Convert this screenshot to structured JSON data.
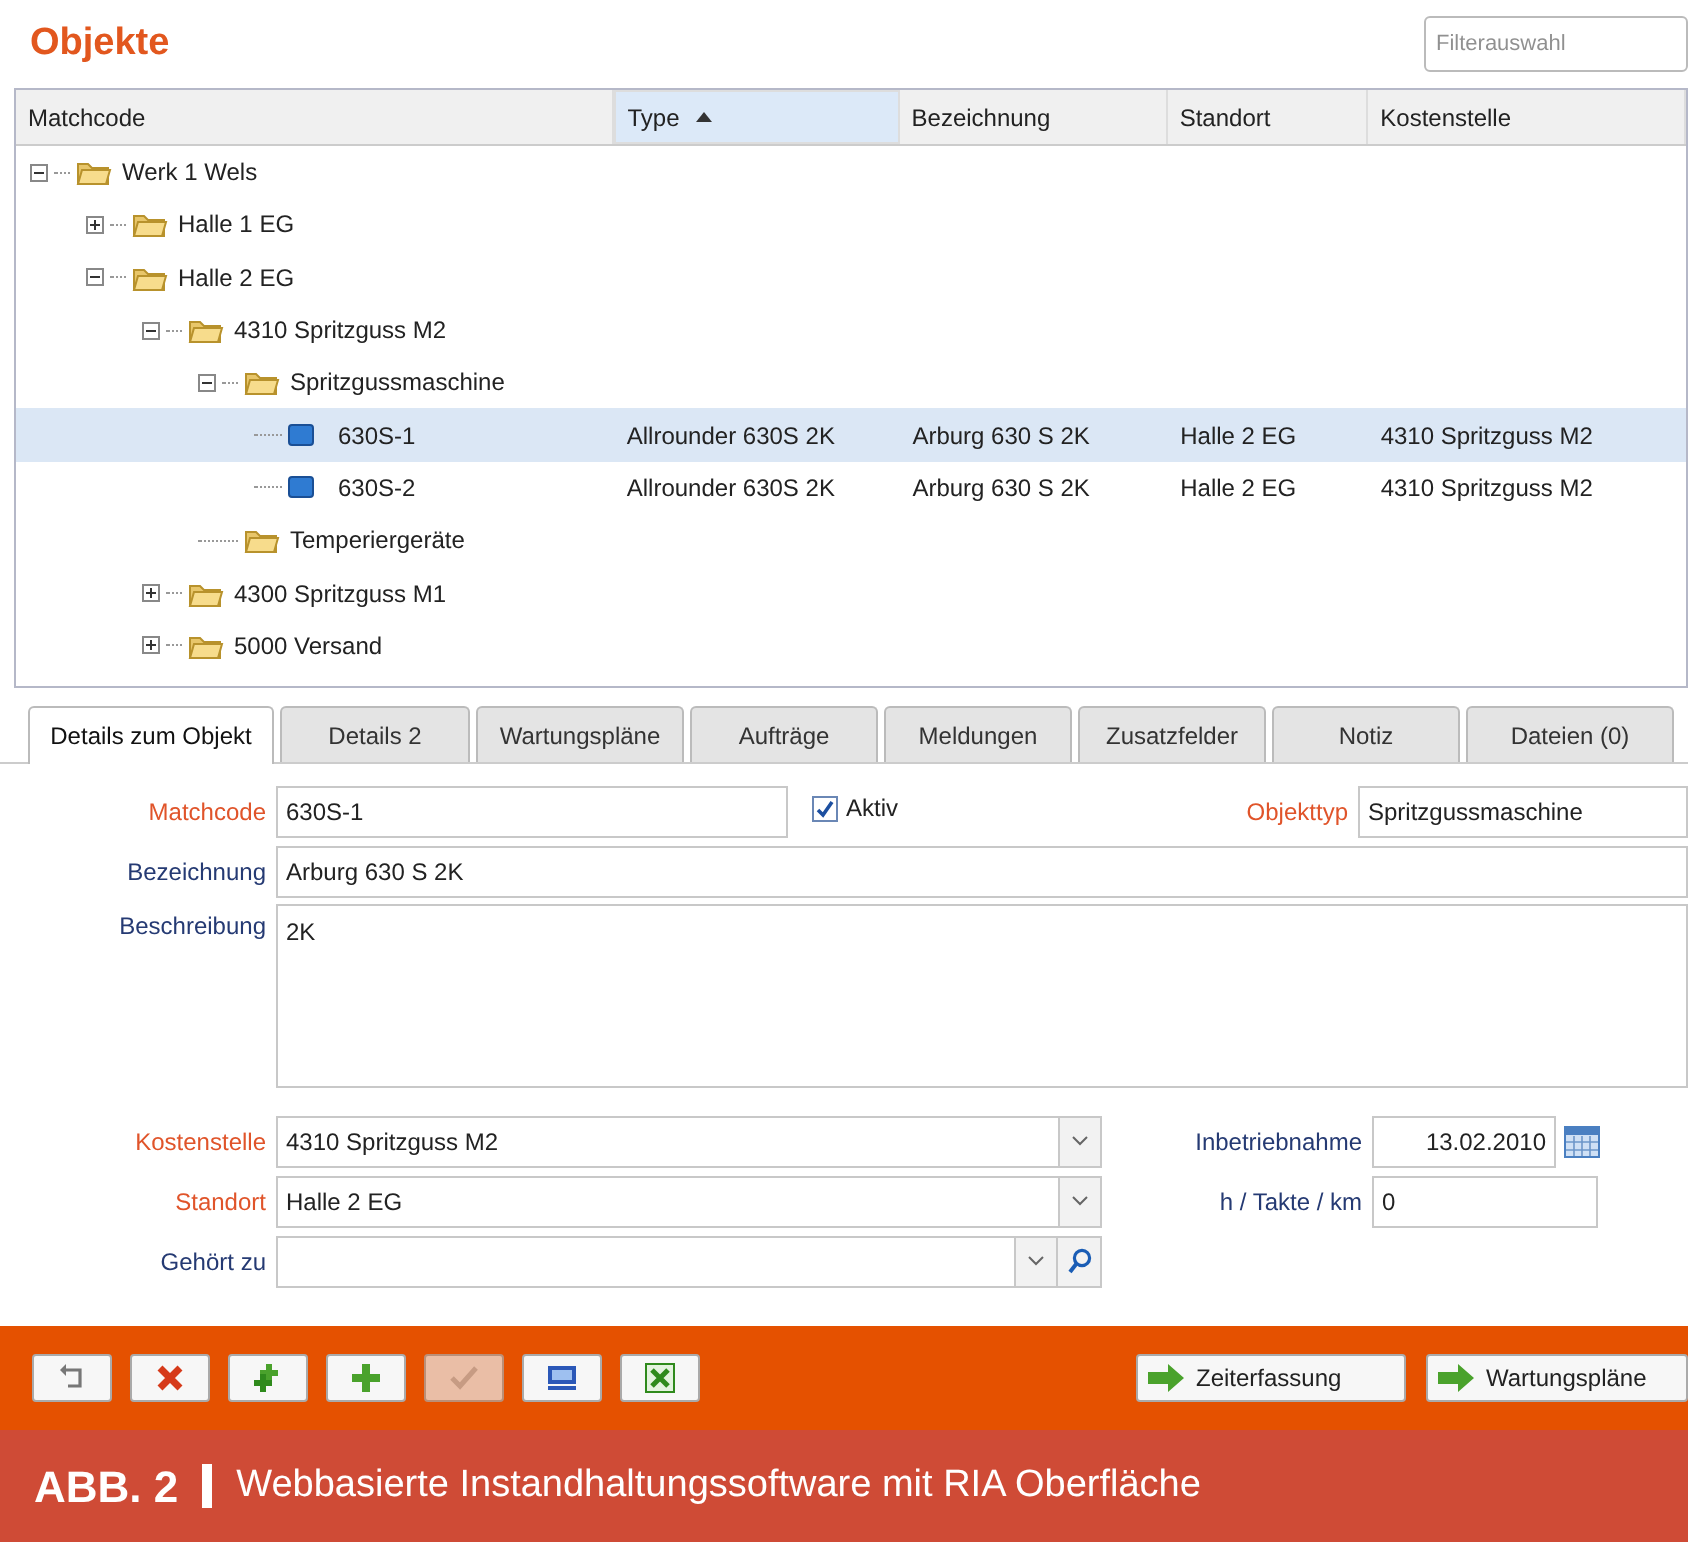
{
  "title": "Objekte",
  "filter": {
    "placeholder": "Filterauswahl"
  },
  "grid": {
    "columns": [
      {
        "label": "Matchcode",
        "sorted": false
      },
      {
        "label": "Type",
        "sorted": true
      },
      {
        "label": "Bezeichnung",
        "sorted": false
      },
      {
        "label": "Standort",
        "sorted": false
      },
      {
        "label": "Kostenstelle",
        "sorted": false
      }
    ],
    "tree": [
      {
        "kind": "folder",
        "label": "Werk 1 Wels",
        "expanded": true,
        "selected": false,
        "children": [
          {
            "kind": "folder",
            "label": "Halle 1 EG",
            "expanded": false,
            "selected": false
          },
          {
            "kind": "folder",
            "label": "Halle 2 EG",
            "expanded": true,
            "selected": false,
            "children": [
              {
                "kind": "folder",
                "label": "4310 Spritzguss M2",
                "expanded": true,
                "selected": false,
                "children": [
                  {
                    "kind": "folder",
                    "label": "Spritzgussmaschine",
                    "expanded": true,
                    "selected": false,
                    "children": [
                      {
                        "kind": "object",
                        "label": "630S-1",
                        "selected": true,
                        "cells": [
                          "Allrounder 630S 2K",
                          "Arburg 630 S 2K",
                          "Halle 2 EG",
                          "4310 Spritzguss M2"
                        ]
                      },
                      {
                        "kind": "object",
                        "label": "630S-2",
                        "selected": false,
                        "cells": [
                          "Allrounder 630S 2K",
                          "Arburg 630 S 2K",
                          "Halle 2 EG",
                          "4310 Spritzguss M2"
                        ]
                      }
                    ]
                  },
                  {
                    "kind": "leaf-folder",
                    "label": "Temperiergeräte",
                    "selected": false
                  }
                ]
              },
              {
                "kind": "folder",
                "label": "4300 Spritzguss M1",
                "expanded": false,
                "selected": false
              },
              {
                "kind": "folder",
                "label": "5000 Versand",
                "expanded": false,
                "selected": false
              }
            ]
          }
        ]
      }
    ]
  },
  "tabs": [
    {
      "label": "Details zum Objekt",
      "selected": true
    },
    {
      "label": "Details 2",
      "selected": false
    },
    {
      "label": "Wartungspläne",
      "selected": false
    },
    {
      "label": "Aufträge",
      "selected": false
    },
    {
      "label": "Meldungen",
      "selected": false
    },
    {
      "label": "Zusatzfelder",
      "selected": false
    },
    {
      "label": "Notiz",
      "selected": false
    },
    {
      "label": "Dateien (0)",
      "selected": false
    }
  ],
  "form": {
    "matchcode": {
      "label": "Matchcode",
      "required": true,
      "value": "630S-1"
    },
    "aktiv": {
      "label": "Aktiv",
      "checked": true
    },
    "objekttyp": {
      "label": "Objekttyp",
      "required": true,
      "value": "Spritzgussmaschine"
    },
    "bezeichnung": {
      "label": "Bezeichnung",
      "required": false,
      "value": "Arburg 630 S 2K"
    },
    "beschreibung": {
      "label": "Beschreibung",
      "required": false,
      "value": "2K"
    },
    "kostenstelle": {
      "label": "Kostenstelle",
      "required": true,
      "value": "4310 Spritzguss M2"
    },
    "standort": {
      "label": "Standort",
      "required": true,
      "value": "Halle 2 EG"
    },
    "gehoert_zu": {
      "label": "Gehört zu",
      "required": false
    },
    "inbetriebnahme": {
      "label": "Inbetriebnahme",
      "value": "13.02.2010"
    },
    "takte": {
      "label": "h / Takte / km",
      "value": "0"
    }
  },
  "toolbar": {
    "icon_buttons": [
      {
        "kind": "undo",
        "disabled": false
      },
      {
        "kind": "delete",
        "disabled": false
      },
      {
        "kind": "copy",
        "disabled": false
      },
      {
        "kind": "add",
        "disabled": false
      },
      {
        "kind": "confirm",
        "disabled": true
      },
      {
        "kind": "save",
        "disabled": false
      },
      {
        "kind": "excel",
        "disabled": false
      }
    ],
    "link_buttons": [
      {
        "label": "Zeiterfassung"
      },
      {
        "label": "Wartungspläne"
      }
    ]
  },
  "caption": {
    "label": "ABB. 2",
    "text": "Webbasierte Instandhaltungssoftware mit RIA Oberfläche"
  }
}
